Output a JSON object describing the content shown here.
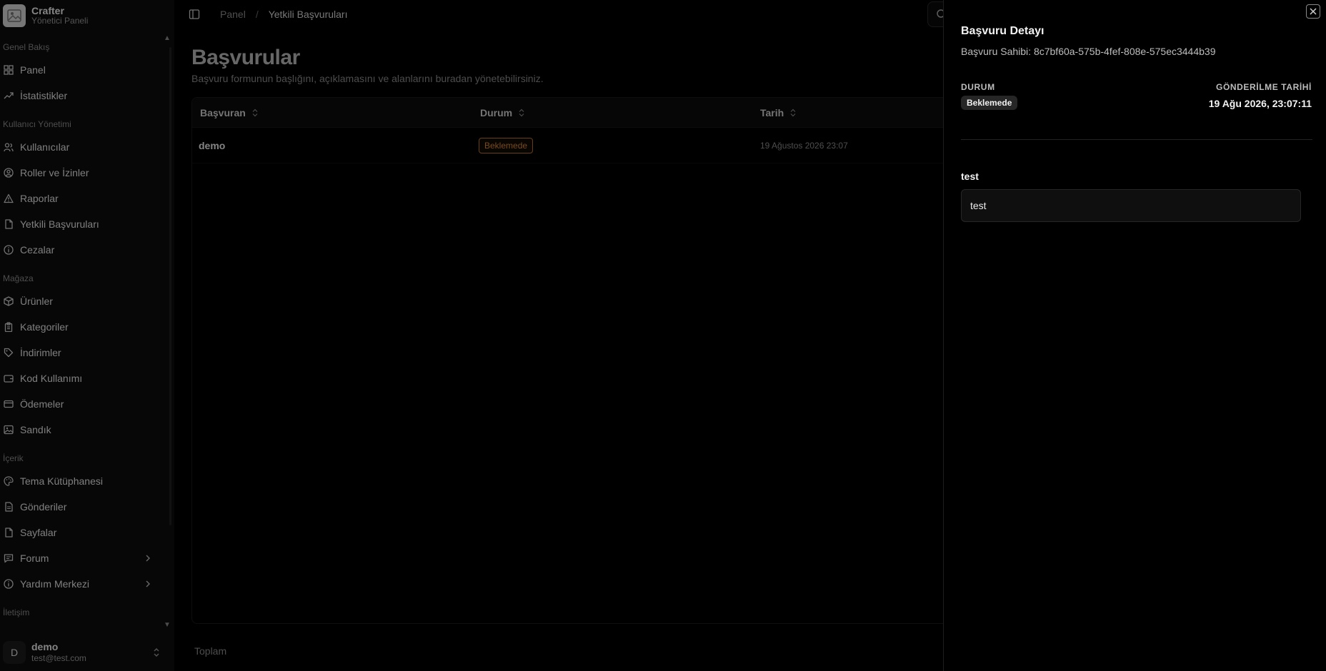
{
  "brand": {
    "name": "Crafter",
    "subtitle": "Yönetici Paneli"
  },
  "sidebar": {
    "groups": [
      {
        "label": "Genel Bakış",
        "items": [
          {
            "label": "Panel",
            "icon": "grid-icon"
          },
          {
            "label": "İstatistikler",
            "icon": "trending-up-icon"
          }
        ]
      },
      {
        "label": "Kullanıcı Yönetimi",
        "items": [
          {
            "label": "Kullanıcılar",
            "icon": "users-icon"
          },
          {
            "label": "Roller ve İzinler",
            "icon": "user-circle-icon"
          },
          {
            "label": "Raporlar",
            "icon": "warning-icon"
          },
          {
            "label": "Yetkili Başvuruları",
            "icon": "file-icon"
          },
          {
            "label": "Cezalar",
            "icon": "info-icon"
          }
        ]
      },
      {
        "label": "Mağaza",
        "items": [
          {
            "label": "Ürünler",
            "icon": "box-icon"
          },
          {
            "label": "Kategoriler",
            "icon": "clipboard-icon"
          },
          {
            "label": "İndirimler",
            "icon": "tag-icon"
          },
          {
            "label": "Kod Kullanımı",
            "icon": "wallet-icon"
          },
          {
            "label": "Ödemeler",
            "icon": "credit-card-icon"
          },
          {
            "label": "Sandık",
            "icon": "image-icon"
          }
        ]
      },
      {
        "label": "İçerik",
        "items": [
          {
            "label": "Tema Kütüphanesi",
            "icon": "palette-icon"
          },
          {
            "label": "Gönderiler",
            "icon": "file-text-icon"
          },
          {
            "label": "Sayfalar",
            "icon": "file-icon"
          },
          {
            "label": "Forum",
            "icon": "message-icon",
            "expandable": true
          },
          {
            "label": "Yardım Merkezi",
            "icon": "info-icon",
            "expandable": true
          }
        ]
      },
      {
        "label": "İletişim",
        "items": []
      }
    ]
  },
  "user": {
    "initial": "D",
    "name": "demo",
    "email": "test@test.com"
  },
  "breadcrumb": {
    "parent": "Panel",
    "separator": "/",
    "current": "Yetkili Başvuruları"
  },
  "page": {
    "title": "Başvurular",
    "description": "Başvuru formunun başlığını, açıklamasını ve alanlarını buradan yönetebilirsiniz."
  },
  "table": {
    "columns": [
      "Başvuran",
      "Durum",
      "Tarih"
    ],
    "rows": [
      {
        "applicant": "demo",
        "status": "Beklemede",
        "date": "19 Ağustos 2026 23:07"
      }
    ],
    "footer": "Toplam"
  },
  "detail": {
    "title": "Başvuru Detayı",
    "owner": "Başvuru Sahibi: 8c7bf60a-575b-4fef-808e-575ec3444b39",
    "status_label": "DURUM",
    "status_value": "Beklemede",
    "date_label": "GÖNDERİLME TARİHİ",
    "date_value": "19 Ağu 2026, 23:07:11",
    "fields": [
      {
        "label": "test",
        "value": "test"
      }
    ]
  },
  "colors": {
    "accent_status": "#d98a36",
    "background": "#000000",
    "sidebar": "#0e0e0e"
  }
}
